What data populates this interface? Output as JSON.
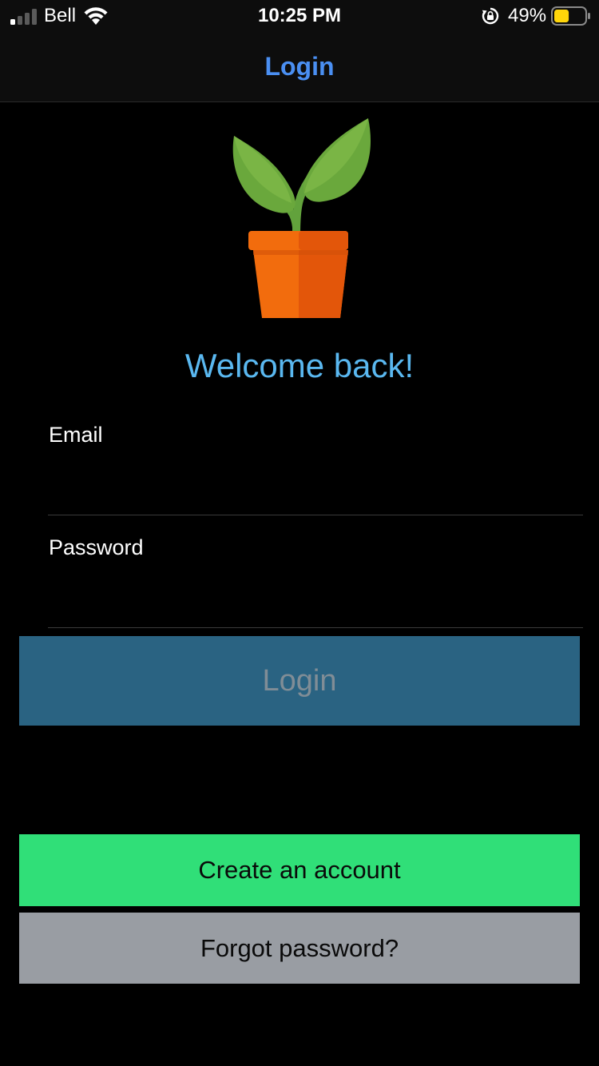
{
  "status_bar": {
    "carrier": "Bell",
    "time": "10:25 PM",
    "battery_percent": "49%",
    "signal_bars_active": 1,
    "signal_bars_total": 4,
    "battery_level": 0.49,
    "battery_color": "#ffd60a",
    "icons": [
      "signal-icon",
      "wifi-icon",
      "rotation-lock-icon",
      "battery-icon"
    ]
  },
  "nav": {
    "title": "Login",
    "title_color": "#4a8ff2"
  },
  "logo": {
    "icon": "potted-plant-icon"
  },
  "welcome": {
    "text": "Welcome back!",
    "color": "#5ab8f0"
  },
  "form": {
    "email": {
      "label": "Email",
      "value": "",
      "placeholder": ""
    },
    "password": {
      "label": "Password",
      "value": "",
      "placeholder": ""
    }
  },
  "buttons": {
    "login": {
      "label": "Login",
      "color": "#2a6382"
    },
    "create_account": {
      "label": "Create an account",
      "color": "#30df78"
    },
    "forgot_password": {
      "label": "Forgot password?",
      "color": "#999da3"
    }
  }
}
